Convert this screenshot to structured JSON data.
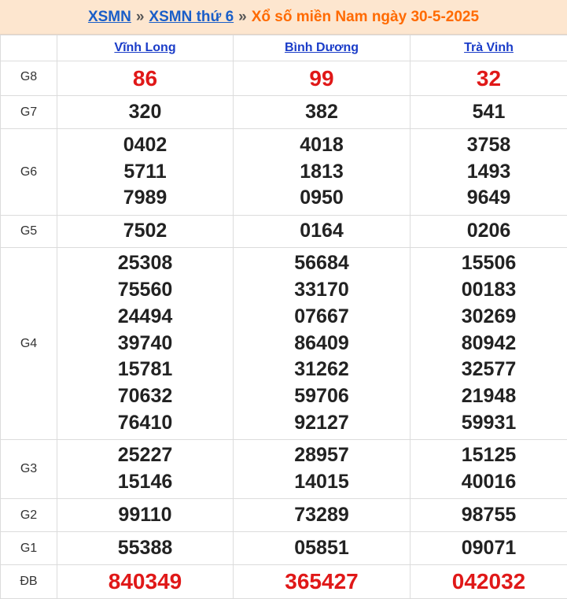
{
  "breadcrumb": {
    "home": "XSMN",
    "sep1": "»",
    "day": "XSMN thứ 6",
    "sep2": "»",
    "current": "Xổ số miền Nam ngày 30-5-2025"
  },
  "provinces": [
    "Vĩnh Long",
    "Bình Dương",
    "Trà Vinh"
  ],
  "colors": {
    "header_bg": "#fde6cf",
    "link": "#1a5ec8",
    "current": "#ff6a00",
    "special": "#e01818"
  },
  "rows": [
    {
      "label": "G8",
      "values": [
        [
          "86"
        ],
        [
          "99"
        ],
        [
          "32"
        ]
      ]
    },
    {
      "label": "G7",
      "values": [
        [
          "320"
        ],
        [
          "382"
        ],
        [
          "541"
        ]
      ]
    },
    {
      "label": "G6",
      "values": [
        [
          "0402",
          "5711",
          "7989"
        ],
        [
          "4018",
          "1813",
          "0950"
        ],
        [
          "3758",
          "1493",
          "9649"
        ]
      ]
    },
    {
      "label": "G5",
      "values": [
        [
          "7502"
        ],
        [
          "0164"
        ],
        [
          "0206"
        ]
      ]
    },
    {
      "label": "G4",
      "values": [
        [
          "25308",
          "75560",
          "24494",
          "39740",
          "15781",
          "70632",
          "76410"
        ],
        [
          "56684",
          "33170",
          "07667",
          "86409",
          "31262",
          "59706",
          "92127"
        ],
        [
          "15506",
          "00183",
          "30269",
          "80942",
          "32577",
          "21948",
          "59931"
        ]
      ]
    },
    {
      "label": "G3",
      "values": [
        [
          "25227",
          "15146"
        ],
        [
          "28957",
          "14015"
        ],
        [
          "15125",
          "40016"
        ]
      ]
    },
    {
      "label": "G2",
      "values": [
        [
          "99110"
        ],
        [
          "73289"
        ],
        [
          "98755"
        ]
      ]
    },
    {
      "label": "G1",
      "values": [
        [
          "55388"
        ],
        [
          "05851"
        ],
        [
          "09071"
        ]
      ]
    },
    {
      "label": "ĐB",
      "values": [
        [
          "840349"
        ],
        [
          "365427"
        ],
        [
          "042032"
        ]
      ]
    }
  ]
}
